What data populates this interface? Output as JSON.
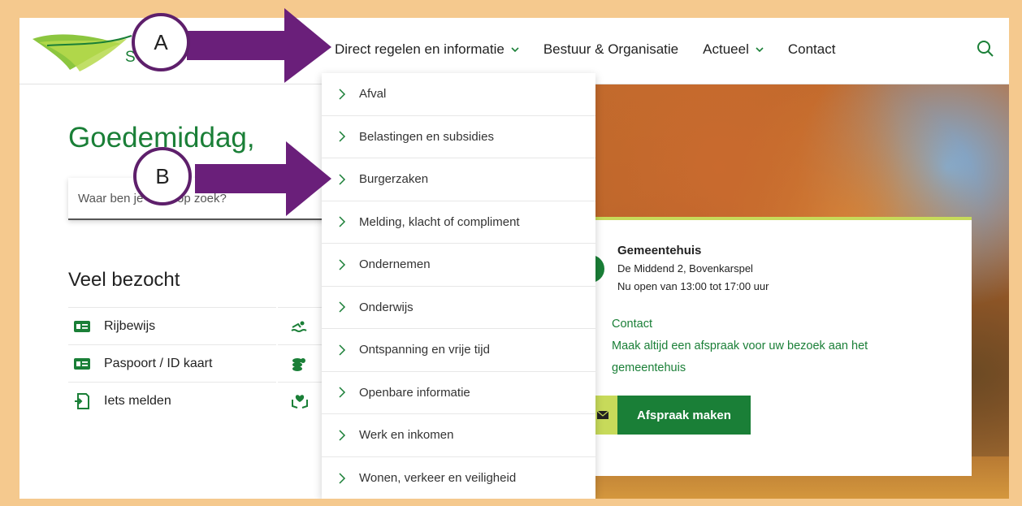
{
  "header": {
    "logo_text": "S      roec",
    "nav": [
      {
        "label": "Direct regelen en informatie",
        "has_chevron": true
      },
      {
        "label": "Bestuur & Organisatie",
        "has_chevron": false
      },
      {
        "label": "Actueel",
        "has_chevron": true
      },
      {
        "label": "Contact",
        "has_chevron": false
      }
    ],
    "search_icon": "search-icon"
  },
  "main": {
    "greeting": "Goedemiddag,",
    "search_placeholder": "Waar ben je          op zoek?",
    "popular_title": "Veel bezocht",
    "popular_items": [
      {
        "label": "Rijbewijs",
        "icon": "id-card-icon"
      },
      {
        "label": "Paspoort / ID kaart",
        "icon": "id-card-icon"
      },
      {
        "label": "Iets melden",
        "icon": "report-icon"
      }
    ],
    "popular_col2_icons": [
      "swimmer-icon",
      "coins-icon",
      "care-hands-icon"
    ]
  },
  "dropdown": {
    "items": [
      "Afval",
      "Belastingen en subsidies",
      "Burgerzaken",
      "Melding, klacht of compliment",
      "Ondernemen",
      "Onderwijs",
      "Ontspanning en vrije tijd",
      "Openbare informatie",
      "Werk en inkomen",
      "Wonen, verkeer en veiligheid"
    ]
  },
  "info_card": {
    "title": "Gemeentehuis",
    "address": "De Middend 2, Bovenkarspel",
    "hours": "Nu open van 13:00 tot 17:00 uur",
    "link_contact": "Contact",
    "link_appointment_line1": "Maak altijd een afspraak voor uw bezoek aan het",
    "link_appointment_line2": "gemeentehuis",
    "button_label": "Afspraak maken"
  },
  "annotations": {
    "badge_a": "A",
    "badge_b": "B"
  },
  "colors": {
    "brand_green": "#1a7f37",
    "accent_lime": "#c7da5a",
    "annotation_purple": "#6a1f7a",
    "frame_orange": "#f5c98e"
  }
}
